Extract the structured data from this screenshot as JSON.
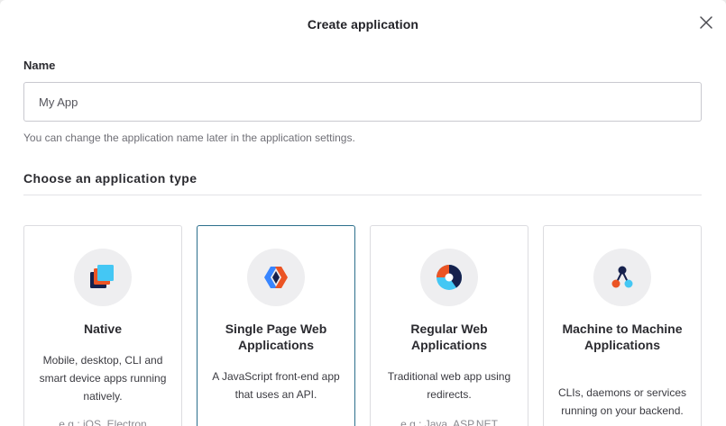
{
  "modal": {
    "title": "Create application",
    "close_icon": "close-icon"
  },
  "name_field": {
    "label": "Name",
    "value": "My App",
    "hint": "You can change the application name later in the application settings."
  },
  "app_type": {
    "section_title": "Choose an application type",
    "selected": "Single Page Web Applications",
    "cards": [
      {
        "icon": "native-app-icon",
        "title": "Native",
        "description": "Mobile, desktop, CLI and smart device apps running natively.",
        "example": "e.g.: iOS, Electron"
      },
      {
        "icon": "spa-icon",
        "title": "Single Page Web Applications",
        "description": "A JavaScript front-end app that uses an API."
      },
      {
        "icon": "regular-web-app-icon",
        "title": "Regular Web Applications",
        "description": "Traditional web app using redirects.",
        "example": "e.g.: Java, ASP.NET"
      },
      {
        "icon": "machine-to-machine-icon",
        "title": "Machine to Machine Applications",
        "description": "CLIs, daemons or services running on your backend."
      }
    ]
  },
  "colors": {
    "selected_border": "#2c6f8c",
    "native_icon_light": "#44c7f4",
    "native_icon_dark": "#16214d",
    "native_icon_red": "#eb5424",
    "spa_icon_blue": "#3885ff",
    "spa_icon_red": "#eb5424"
  }
}
